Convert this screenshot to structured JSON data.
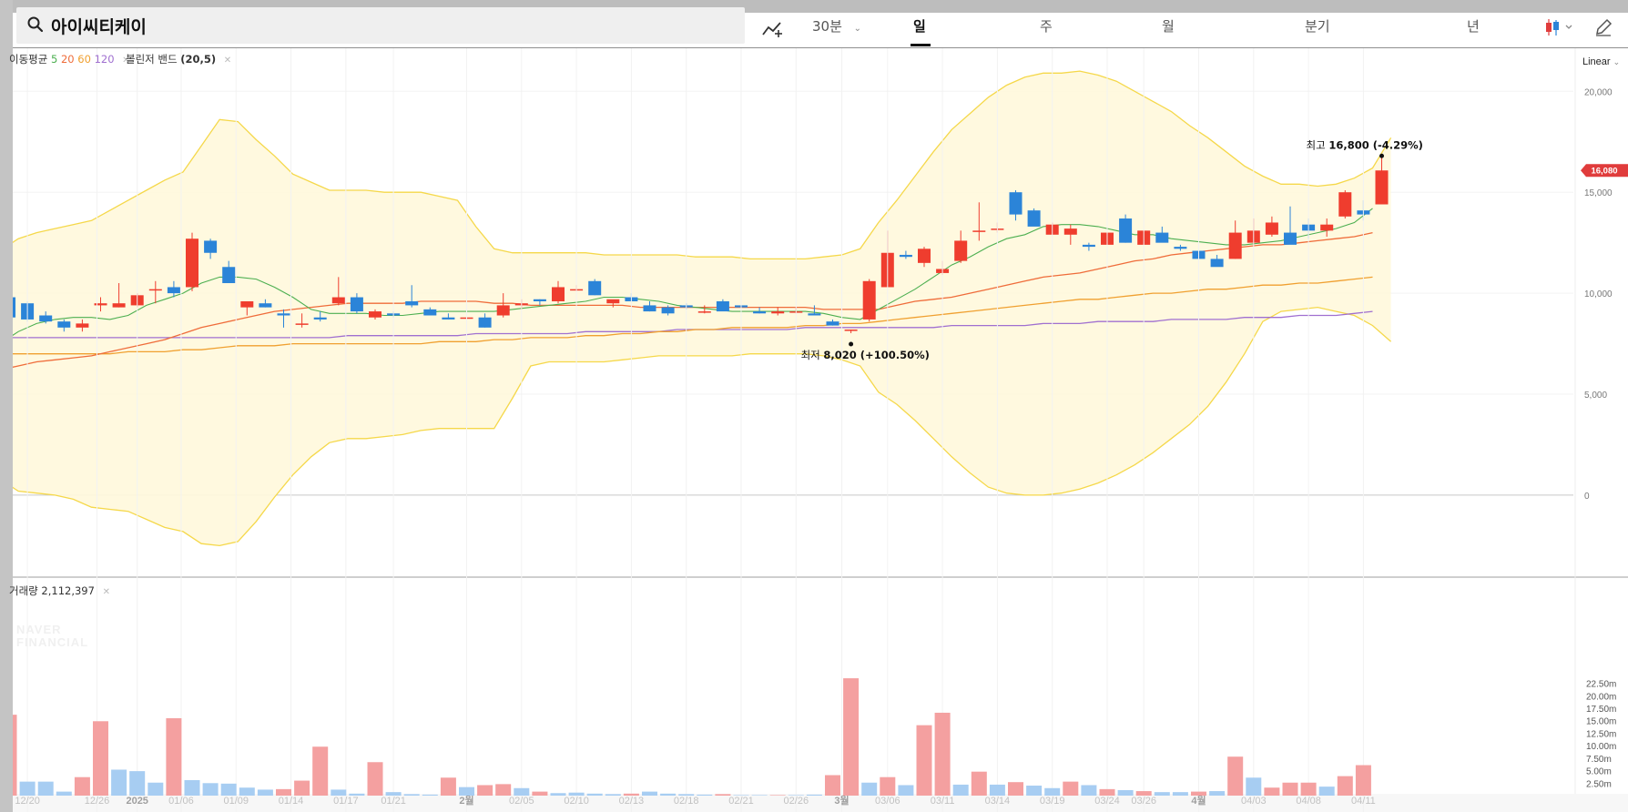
{
  "search": {
    "query": "아이씨티케이"
  },
  "toolbar": {
    "draw_tool": "draw-line-icon",
    "interval": "30분",
    "tabs": [
      "일",
      "주",
      "월",
      "분기",
      "년"
    ],
    "active_tab": "일",
    "chart_style_icon": "candlestick-icon",
    "edit_icon": "pencil-icon"
  },
  "legend": {
    "ma_label": "이동평균",
    "ma_periods": [
      {
        "period": "5",
        "color": "#4caf50"
      },
      {
        "period": "20",
        "color": "#ef6c3a"
      },
      {
        "period": "60",
        "color": "#f0a030"
      },
      {
        "period": "120",
        "color": "#a070d0"
      }
    ],
    "bb_label": "볼린저 밴드",
    "bb_params": "(20,5)",
    "volume_label": "거래량",
    "volume_value": "2,112,397"
  },
  "scale": {
    "type": "Linear"
  },
  "watermark": [
    "NAVER",
    "FINANCIAL"
  ],
  "colors": {
    "up": "#ef3d2e",
    "down": "#2b84d8",
    "up_vol": "#f4a0a0",
    "down_vol": "#a7cdf2",
    "band_fill": "#fff8dc",
    "band_line": "#f5d84a",
    "price_tag": "#e03c3c"
  },
  "chart_data": [
    {
      "type": "candlestick",
      "title": "아이씨티케이",
      "ylim": [
        -3700,
        23800
      ],
      "y_ticks": [
        "0",
        "5,000",
        "10,000",
        "15,000",
        "20,000"
      ],
      "x_tick_labels": [
        "12/20",
        "12/26",
        "2025",
        "01/06",
        "01/09",
        "01/14",
        "01/17",
        "01/21",
        "2월",
        "02/05",
        "02/10",
        "02/13",
        "02/18",
        "02/21",
        "02/26",
        "3월",
        "03/06",
        "03/11",
        "03/14",
        "03/19",
        "03/24",
        "03/26",
        "4월",
        "04/03",
        "04/08",
        "04/11"
      ],
      "candles": [
        [
          9800,
          11000,
          8700,
          8800
        ],
        [
          9500,
          9600,
          8600,
          8700
        ],
        [
          8900,
          9100,
          8500,
          8600
        ],
        [
          8600,
          8700,
          8100,
          8300
        ],
        [
          8300,
          8700,
          8100,
          8500
        ],
        [
          9400,
          9800,
          9100,
          9500
        ],
        [
          9300,
          10500,
          9300,
          9500
        ],
        [
          9400,
          10000,
          9300,
          9900
        ],
        [
          10200,
          10600,
          9500,
          10200
        ],
        [
          10300,
          10600,
          9800,
          10000
        ],
        [
          10300,
          13000,
          10100,
          12700
        ],
        [
          12600,
          12700,
          11700,
          12000
        ],
        [
          11300,
          11600,
          10600,
          10500
        ],
        [
          9300,
          9600,
          8900,
          9600
        ],
        [
          9500,
          9700,
          9300,
          9300
        ],
        [
          9000,
          9200,
          8300,
          8900
        ],
        [
          8500,
          9000,
          8300,
          8500
        ],
        [
          8800,
          9100,
          8600,
          8700
        ],
        [
          9500,
          10800,
          9400,
          9800
        ],
        [
          9800,
          10000,
          9000,
          9100
        ],
        [
          8800,
          9200,
          8700,
          9100
        ],
        [
          9000,
          9100,
          8800,
          8900
        ],
        [
          9600,
          10400,
          9300,
          9400
        ],
        [
          9200,
          9300,
          8900,
          8900
        ],
        [
          8800,
          9000,
          8700,
          8700
        ],
        [
          8800,
          9000,
          8700,
          8800
        ],
        [
          8800,
          9000,
          8300,
          8300
        ],
        [
          8900,
          10000,
          8800,
          9400
        ],
        [
          9400,
          9700,
          9200,
          9500
        ],
        [
          9700,
          9700,
          9400,
          9600
        ],
        [
          9600,
          10600,
          9500,
          10300
        ],
        [
          10200,
          10400,
          10100,
          10200
        ],
        [
          10600,
          10700,
          9900,
          9900
        ],
        [
          9500,
          9600,
          9300,
          9700
        ],
        [
          9800,
          10000,
          9700,
          9600
        ],
        [
          9400,
          9600,
          9100,
          9100
        ],
        [
          9300,
          9400,
          8900,
          9000
        ],
        [
          9400,
          9500,
          9200,
          9300
        ],
        [
          9100,
          9400,
          9000,
          9100
        ],
        [
          9600,
          9700,
          9300,
          9100
        ],
        [
          9400,
          9500,
          9200,
          9300
        ],
        [
          9100,
          9300,
          9000,
          9000
        ],
        [
          9000,
          9300,
          8900,
          9100
        ],
        [
          9100,
          9300,
          9000,
          9100
        ],
        [
          9000,
          9400,
          8900,
          8900
        ],
        [
          8600,
          8700,
          8400,
          8400
        ],
        [
          8200,
          8200,
          8020,
          8200
        ],
        [
          8700,
          10700,
          8600,
          10600
        ],
        [
          10300,
          13100,
          10300,
          12000
        ],
        [
          11900,
          12100,
          11700,
          11800
        ],
        [
          11500,
          12300,
          11300,
          12200
        ],
        [
          11000,
          11600,
          10900,
          11200
        ],
        [
          11600,
          13100,
          11500,
          12600
        ],
        [
          13100,
          14500,
          12600,
          13100
        ],
        [
          13200,
          13500,
          13000,
          13200
        ],
        [
          15000,
          15100,
          13600,
          13900
        ],
        [
          14100,
          14200,
          13400,
          13300
        ],
        [
          12900,
          13500,
          12900,
          13400
        ],
        [
          12900,
          13400,
          12400,
          13200
        ],
        [
          12400,
          12500,
          12100,
          12300
        ],
        [
          12400,
          13200,
          12300,
          13000
        ],
        [
          13700,
          13900,
          12500,
          12500
        ],
        [
          12400,
          12900,
          12500,
          13100
        ],
        [
          13000,
          13300,
          12700,
          12500
        ],
        [
          12300,
          12400,
          12100,
          12200
        ],
        [
          12100,
          12600,
          11800,
          11700
        ],
        [
          11700,
          11900,
          11500,
          11300
        ],
        [
          11700,
          13600,
          11700,
          13000
        ],
        [
          12500,
          13700,
          12400,
          13100
        ],
        [
          12900,
          13800,
          12800,
          13500
        ],
        [
          13000,
          14300,
          12500,
          12400
        ],
        [
          13400,
          13700,
          12700,
          13100
        ],
        [
          13100,
          13700,
          12800,
          13400
        ],
        [
          13800,
          15100,
          13700,
          15000
        ],
        [
          14100,
          14600,
          13600,
          13900
        ],
        [
          14400,
          16800,
          14400,
          16080
        ]
      ],
      "ma5": [
        7500,
        8100,
        8500,
        8700,
        8800,
        8800,
        8700,
        8900,
        9400,
        9700,
        10000,
        10500,
        10800,
        10800,
        10700,
        10300,
        9800,
        9200,
        9000,
        9000,
        9000,
        8900,
        8900,
        9000,
        9100,
        9100,
        9100,
        9100,
        9200,
        9300,
        9400,
        9500,
        9600,
        9800,
        9800,
        9700,
        9600,
        9400,
        9300,
        9200,
        9100,
        9100,
        9100,
        9100,
        9100,
        9000,
        8800,
        8700,
        9200,
        9700,
        10200,
        10800,
        11400,
        11800,
        12300,
        12700,
        12900,
        13300,
        13400,
        13400,
        13300,
        13100,
        12900,
        12900,
        12700,
        12600,
        12500,
        12400,
        12400,
        12500,
        12600,
        12800,
        13000,
        13200,
        13500,
        14200
      ],
      "ma20": [
        6200,
        6400,
        6600,
        6700,
        6800,
        6900,
        7100,
        7300,
        7500,
        7700,
        8000,
        8300,
        8500,
        8700,
        8900,
        9100,
        9200,
        9300,
        9400,
        9500,
        9500,
        9500,
        9500,
        9600,
        9600,
        9600,
        9600,
        9500,
        9500,
        9400,
        9400,
        9400,
        9400,
        9400,
        9400,
        9300,
        9300,
        9300,
        9300,
        9300,
        9300,
        9300,
        9300,
        9300,
        9300,
        9200,
        9200,
        9200,
        9200,
        9400,
        9600,
        9700,
        9800,
        10000,
        10200,
        10400,
        10600,
        10800,
        10900,
        11000,
        11200,
        11400,
        11600,
        11700,
        11900,
        12000,
        12100,
        12200,
        12300,
        12400,
        12400,
        12500,
        12600,
        12700,
        12800,
        13000
      ],
      "ma60": [
        7000,
        7000,
        7000,
        7000,
        7000,
        7000,
        7000,
        7100,
        7100,
        7100,
        7200,
        7200,
        7300,
        7400,
        7400,
        7400,
        7500,
        7500,
        7500,
        7500,
        7500,
        7500,
        7500,
        7500,
        7600,
        7600,
        7600,
        7700,
        7700,
        7800,
        7800,
        7800,
        7900,
        7900,
        8000,
        8000,
        8100,
        8100,
        8200,
        8200,
        8300,
        8300,
        8300,
        8300,
        8400,
        8400,
        8500,
        8500,
        8600,
        8700,
        8800,
        8900,
        9000,
        9100,
        9200,
        9300,
        9400,
        9500,
        9600,
        9700,
        9700,
        9800,
        9900,
        10000,
        10000,
        10100,
        10200,
        10200,
        10300,
        10400,
        10400,
        10500,
        10500,
        10600,
        10700,
        10800
      ],
      "ma120": [
        7800,
        7800,
        7800,
        7800,
        7800,
        7800,
        7800,
        7800,
        7800,
        7800,
        7800,
        7800,
        7800,
        7800,
        7800,
        7800,
        7800,
        7800,
        7800,
        7900,
        7900,
        7900,
        7900,
        7900,
        7900,
        7900,
        8000,
        8000,
        8000,
        8000,
        8000,
        8000,
        8100,
        8100,
        8100,
        8100,
        8100,
        8200,
        8200,
        8200,
        8200,
        8200,
        8200,
        8200,
        8300,
        8300,
        8300,
        8300,
        8300,
        8300,
        8300,
        8300,
        8400,
        8400,
        8400,
        8400,
        8400,
        8500,
        8500,
        8500,
        8600,
        8600,
        8600,
        8600,
        8700,
        8700,
        8700,
        8700,
        8800,
        8800,
        8800,
        8900,
        8900,
        8900,
        9000,
        9100
      ],
      "bb_upper": [
        12100,
        12700,
        13000,
        13200,
        13400,
        13600,
        14100,
        14600,
        15100,
        15600,
        16000,
        17300,
        18600,
        18500,
        17600,
        16800,
        15900,
        15500,
        15100,
        15100,
        15100,
        15000,
        15000,
        15000,
        14800,
        14600,
        13300,
        12200,
        12000,
        12000,
        12000,
        12000,
        12000,
        11900,
        11900,
        11900,
        11900,
        11900,
        11800,
        11800,
        11800,
        11700,
        11700,
        11700,
        11700,
        11800,
        11900,
        12200,
        13500,
        14600,
        15800,
        17000,
        18100,
        18900,
        19700,
        20300,
        20700,
        20900,
        20900,
        21000,
        20800,
        20500,
        20000,
        19500,
        19000,
        18300,
        17700,
        17000,
        16300,
        15800,
        15400,
        15400,
        15300,
        15400,
        15700,
        16200,
        17700
      ],
      "bb_lower": [
        800,
        200,
        100,
        0,
        -200,
        -600,
        -700,
        -800,
        -1200,
        -1600,
        -1800,
        -2400,
        -2500,
        -2300,
        -1300,
        -100,
        1000,
        1900,
        2600,
        2800,
        2800,
        2900,
        3000,
        3200,
        3300,
        3300,
        3300,
        3300,
        4800,
        6400,
        6600,
        6600,
        6600,
        6600,
        6700,
        6800,
        6900,
        6900,
        6900,
        6900,
        6900,
        7000,
        7000,
        7000,
        7000,
        6900,
        6700,
        6400,
        5100,
        4500,
        3700,
        2800,
        1900,
        1100,
        400,
        100,
        0,
        0,
        100,
        300,
        600,
        1000,
        1500,
        2100,
        2800,
        3500,
        4400,
        5600,
        7000,
        8600,
        9100,
        9200,
        9300,
        9100,
        8900,
        8400,
        7600
      ],
      "low_annotation": {
        "label": "최저",
        "value": "8,020",
        "change": "(+100.50%)"
      },
      "high_annotation": {
        "label": "최고",
        "value": "16,800",
        "change": "(-4.29%)"
      },
      "last_price": "16,080"
    },
    {
      "type": "bar",
      "title": "거래량",
      "ylim": [
        0,
        23700000
      ],
      "y_ticks": [
        "2.50m",
        "5.00m",
        "7.50m",
        "10.00m",
        "12.50m",
        "15.00m",
        "17.50m",
        "20.00m",
        "22.50m"
      ],
      "values": [
        16200000,
        2800000,
        2800000,
        800000,
        3700000,
        14900000,
        5200000,
        4900000,
        2600000,
        15500000,
        3100000,
        2500000,
        2400000,
        1600000,
        1200000,
        1300000,
        3000000,
        9800000,
        1200000,
        400000,
        6700000,
        700000,
        300000,
        200000,
        3600000,
        1700000,
        2100000,
        2300000,
        1500000,
        800000,
        500000,
        600000,
        400000,
        300000,
        400000,
        800000,
        400000,
        300000,
        200000,
        300000,
        100000,
        100000,
        100000,
        100000,
        200000,
        4100000,
        23500000,
        2600000,
        3700000,
        2100000,
        14100000,
        16600000,
        2200000,
        4800000,
        2200000,
        2700000,
        2000000,
        1500000,
        2800000,
        2100000,
        1300000,
        1100000,
        900000,
        700000,
        700000,
        800000,
        900000,
        7800000,
        3600000,
        1600000,
        2600000,
        2600000,
        1800000,
        3900000,
        6100000
      ],
      "up": [
        1,
        0,
        0,
        0,
        1,
        1,
        0,
        0,
        0,
        1,
        0,
        0,
        0,
        0,
        0,
        1,
        1,
        1,
        0,
        0,
        1,
        0,
        0,
        0,
        1,
        0,
        1,
        1,
        0,
        1,
        0,
        0,
        0,
        0,
        1,
        0,
        0,
        0,
        0,
        1,
        0,
        0,
        1,
        0,
        0,
        1,
        1,
        0,
        1,
        0,
        1,
        1,
        0,
        1,
        0,
        1,
        0,
        0,
        1,
        0,
        1,
        0,
        1,
        0,
        0,
        1,
        0,
        1,
        0,
        1,
        1,
        1,
        0,
        1,
        1
      ]
    }
  ]
}
